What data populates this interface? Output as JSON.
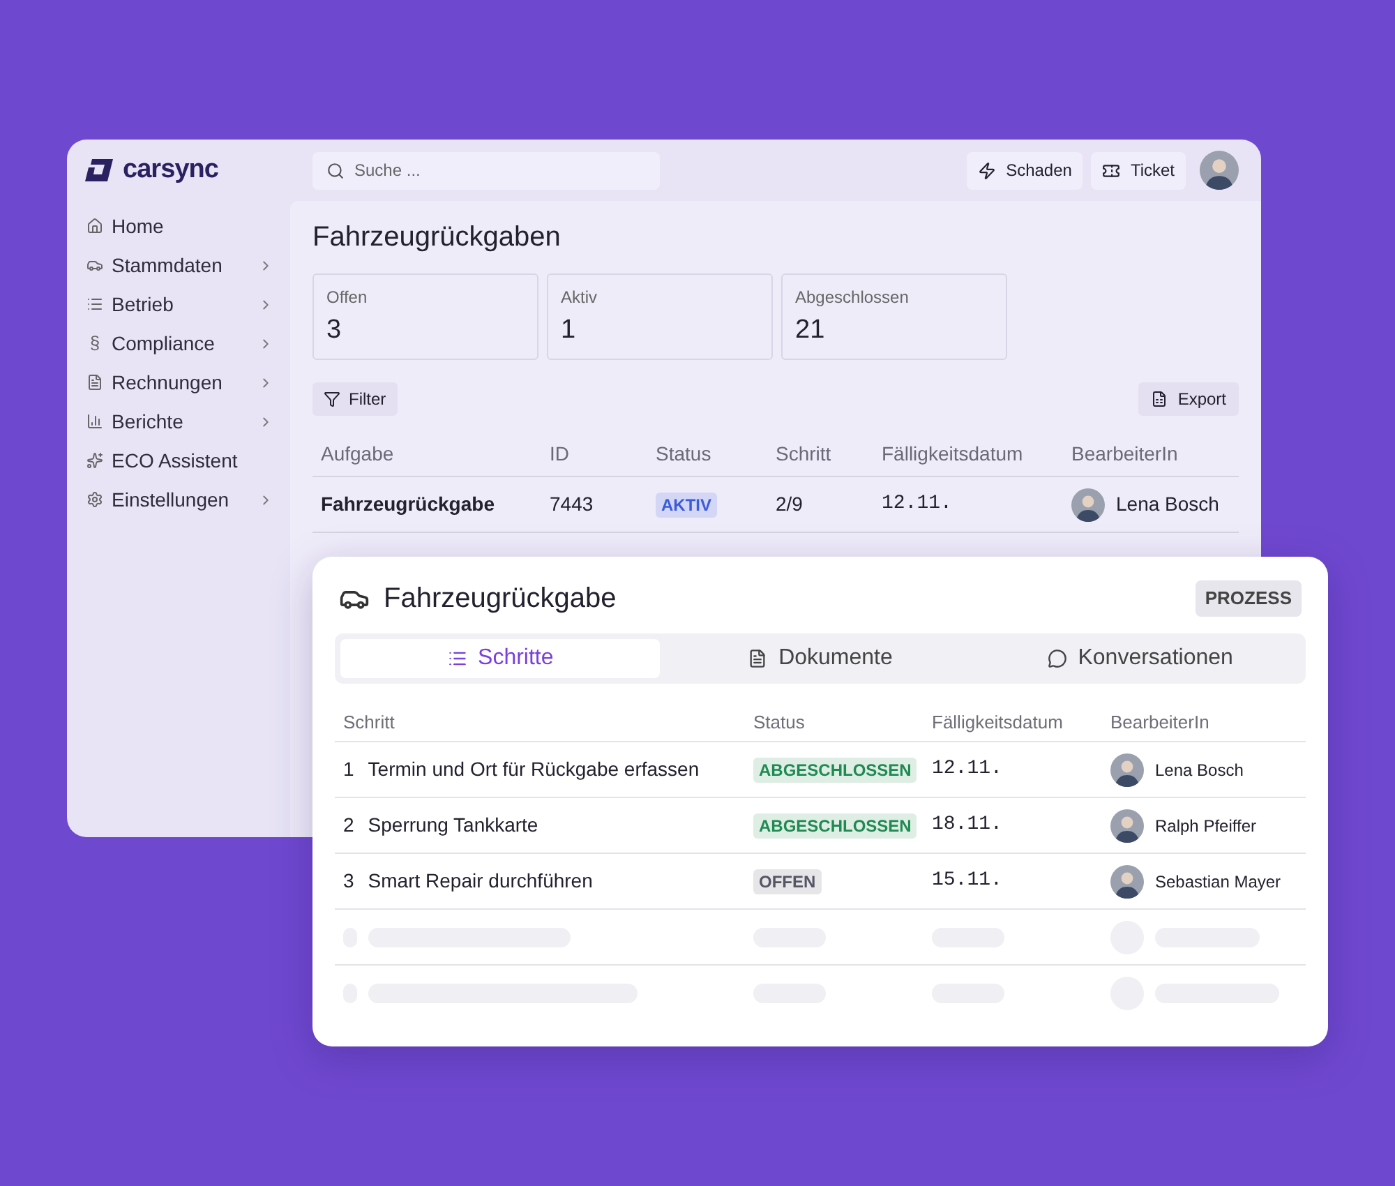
{
  "app": {
    "logo": "carsync",
    "search": {
      "placeholder": "Suche ..."
    },
    "actions": [
      {
        "label": "Schaden"
      },
      {
        "label": "Ticket"
      }
    ]
  },
  "sidebar": {
    "items": [
      {
        "label": "Home",
        "has_submenu": false
      },
      {
        "label": "Stammdaten",
        "has_submenu": true
      },
      {
        "label": "Betrieb",
        "has_submenu": true
      },
      {
        "label": "Compliance",
        "glyph": "§",
        "has_submenu": true
      },
      {
        "label": "Rechnungen",
        "has_submenu": true
      },
      {
        "label": "Berichte",
        "has_submenu": true
      },
      {
        "label": "ECO Assistent",
        "has_submenu": false
      },
      {
        "label": "Einstellungen",
        "has_submenu": true
      }
    ]
  },
  "page": {
    "title": "Fahrzeugrückgaben",
    "stats": [
      {
        "label": "Offen",
        "value": "3"
      },
      {
        "label": "Aktiv",
        "value": "1"
      },
      {
        "label": "Abgeschlossen",
        "value": "21"
      }
    ],
    "filter_button": "Filter",
    "export_button": "Export",
    "table": {
      "columns": [
        "Aufgabe",
        "ID",
        "Status",
        "Schritt",
        "Fälligkeitsdatum",
        "BearbeiterIn"
      ],
      "rows": [
        {
          "task": "Fahrzeugrückgabe",
          "id": "7443",
          "status": "AKTIV",
          "color": "#3b5bdb",
          "step": "2/9",
          "due": "12.11.",
          "assignee": "Lena Bosch"
        }
      ]
    }
  },
  "detail": {
    "title": "Fahrzeugrückgabe",
    "badge": "PROZESS",
    "tabs": [
      {
        "label": "Schritte",
        "selected": true
      },
      {
        "label": "Dokumente",
        "selected": false
      },
      {
        "label": "Konversationen",
        "selected": false
      }
    ],
    "table": {
      "columns": [
        "Schritt",
        "Status",
        "Fälligkeitsdatum",
        "BearbeiterIn"
      ],
      "rows": [
        {
          "number": "1",
          "step": "Termin und Ort für Rückgabe erfassen",
          "status": "ABGESCHLOSSEN",
          "color": "#1f8a52",
          "due": "12.11.",
          "assignee": "Lena Bosch"
        },
        {
          "number": "2",
          "step": "Sperrung Tankkarte",
          "status": "ABGESCHLOSSEN",
          "color": "#1f8a52",
          "due": "18.11.",
          "assignee": "Ralph Pfeiffer"
        },
        {
          "number": "3",
          "step": "Smart Repair durchführen",
          "status": "OFFEN",
          "color": "#555566",
          "due": "15.11.",
          "assignee": "Sebastian Mayer"
        }
      ]
    }
  }
}
